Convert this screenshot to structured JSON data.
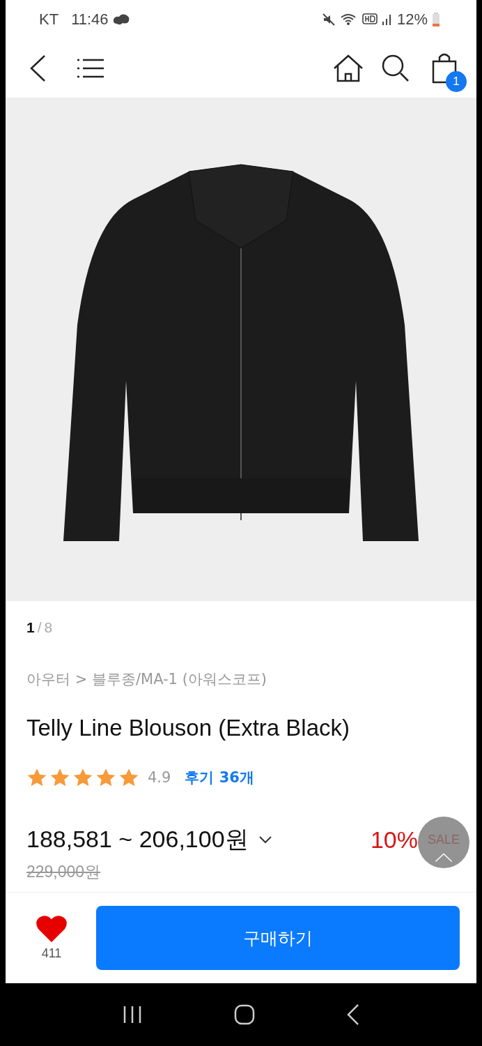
{
  "status_bar": {
    "carrier": "KT",
    "time": "11:46",
    "battery": "12%"
  },
  "header": {
    "cart_count": "1"
  },
  "gallery": {
    "current": "1",
    "separator": "/",
    "total": "8"
  },
  "product": {
    "breadcrumb": "아우터 > 블루종/MA-1 (아워스코프)",
    "title": "Telly Line Blouson (Extra Black)",
    "stars": 5,
    "rating": "4.9",
    "reviews": "후기 36개",
    "price": "188,581 ~ 206,100원",
    "discount": "10%",
    "sale_label": "SALE",
    "original_price": "229,000원"
  },
  "bottom_bar": {
    "likes": "411",
    "liked": true,
    "buy_button": "구매하기"
  }
}
